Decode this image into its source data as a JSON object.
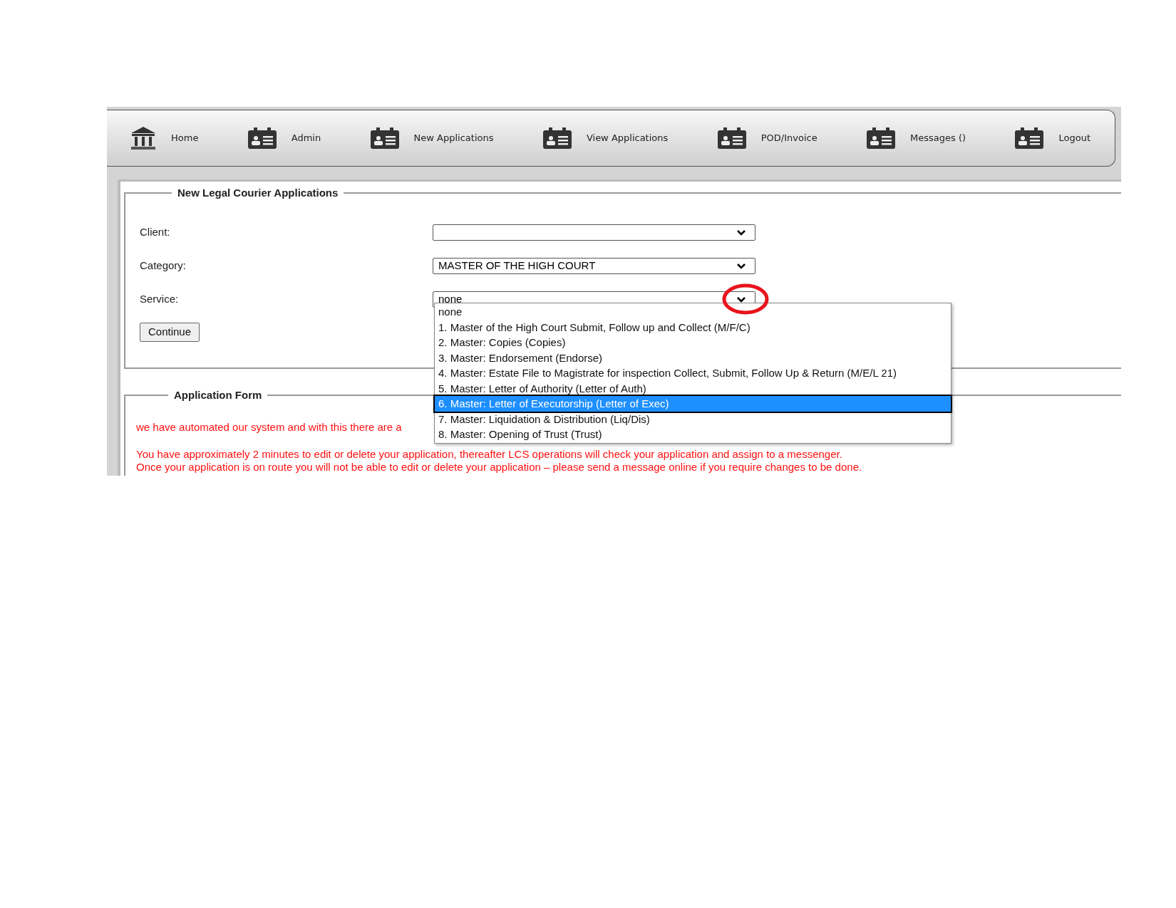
{
  "nav": {
    "items": [
      {
        "label": "Home",
        "kind": "bank"
      },
      {
        "label": "Admin",
        "kind": "card"
      },
      {
        "label": "New Applications",
        "kind": "card"
      },
      {
        "label": "View Applications",
        "kind": "card"
      },
      {
        "label": "POD/Invoice",
        "kind": "card"
      },
      {
        "label": "Messages ()",
        "kind": "card"
      },
      {
        "label": "Logout",
        "kind": "card"
      }
    ]
  },
  "new_application": {
    "legend": "New Legal Courier Applications",
    "fields": [
      {
        "label": "Client:"
      },
      {
        "label": "Category:",
        "value": "MASTER OF THE HIGH COURT"
      },
      {
        "label": "Service:",
        "value": "none",
        "highlighted": true
      }
    ],
    "button": "Continue"
  },
  "service_dropdown": {
    "options": [
      {
        "label": "none",
        "selected": false
      },
      {
        "label": "1. Master of the High Court Submit, Follow up and Collect (M/F/C)",
        "selected": false
      },
      {
        "label": "2. Master: Copies (Copies)",
        "selected": false
      },
      {
        "label": "3. Master: Endorsement (Endorse)",
        "selected": false
      },
      {
        "label": "4. Master: Estate File to Magistrate for inspection Collect, Submit, Follow Up & Return (M/E/L 21)",
        "selected": false
      },
      {
        "label": "5. Master: Letter of Authority (Letter of Auth)",
        "selected": false
      },
      {
        "label": "6. Master: Letter of Executorship (Letter of Exec)",
        "selected": true
      },
      {
        "label": "7. Master: Liquidation & Distribution (Liq/Dis)",
        "selected": false
      },
      {
        "label": "8. Master: Opening of Trust (Trust)",
        "selected": false
      }
    ]
  },
  "application_form": {
    "legend": "Application Form",
    "notices": [
      "we have automated our system and with this there are a",
      "You have approximately 2 minutes to edit or delete your application, thereafter LCS operations will check your application and assign to a messenger.",
      "Once your application is on route you will not be able to edit or delete your application – please send a message online if you require changes to be done."
    ]
  }
}
